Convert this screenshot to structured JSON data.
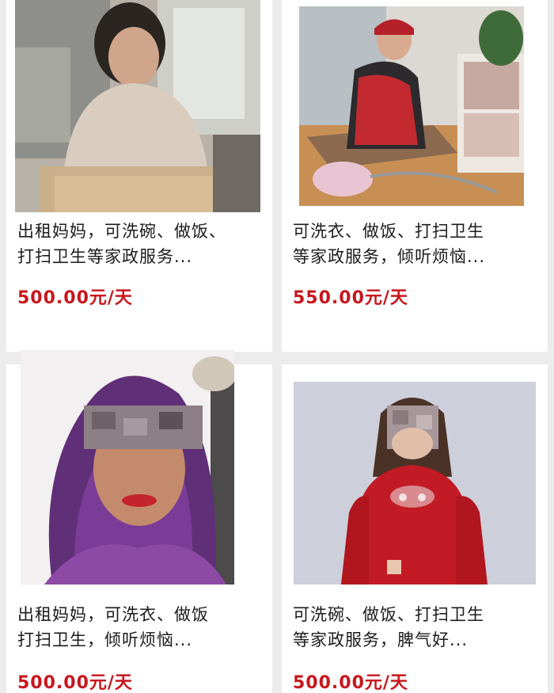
{
  "listings": [
    {
      "title_line1": "出租妈妈，可洗碗、做饭、",
      "title_line2": "打扫卫生等家政服务...",
      "price": "500.00元/天"
    },
    {
      "title_line1": "可洗衣、做饭、打扫卫生",
      "title_line2": "等家政服务，倾听烦恼...",
      "price": "550.00元/天"
    },
    {
      "title_line1": "出租妈妈，可洗衣、做饭",
      "title_line2": "打扫卫生，倾听烦恼...",
      "price": "500.00元/天"
    },
    {
      "title_line1": "可洗碗、做饭、打扫卫生",
      "title_line2": "等家政服务，脾气好...",
      "price": "500.00元/天"
    }
  ],
  "colors": {
    "price": "#c8161d",
    "text": "#1c1c1c",
    "card_bg": "#ffffff",
    "page_bg": "#ececec"
  }
}
